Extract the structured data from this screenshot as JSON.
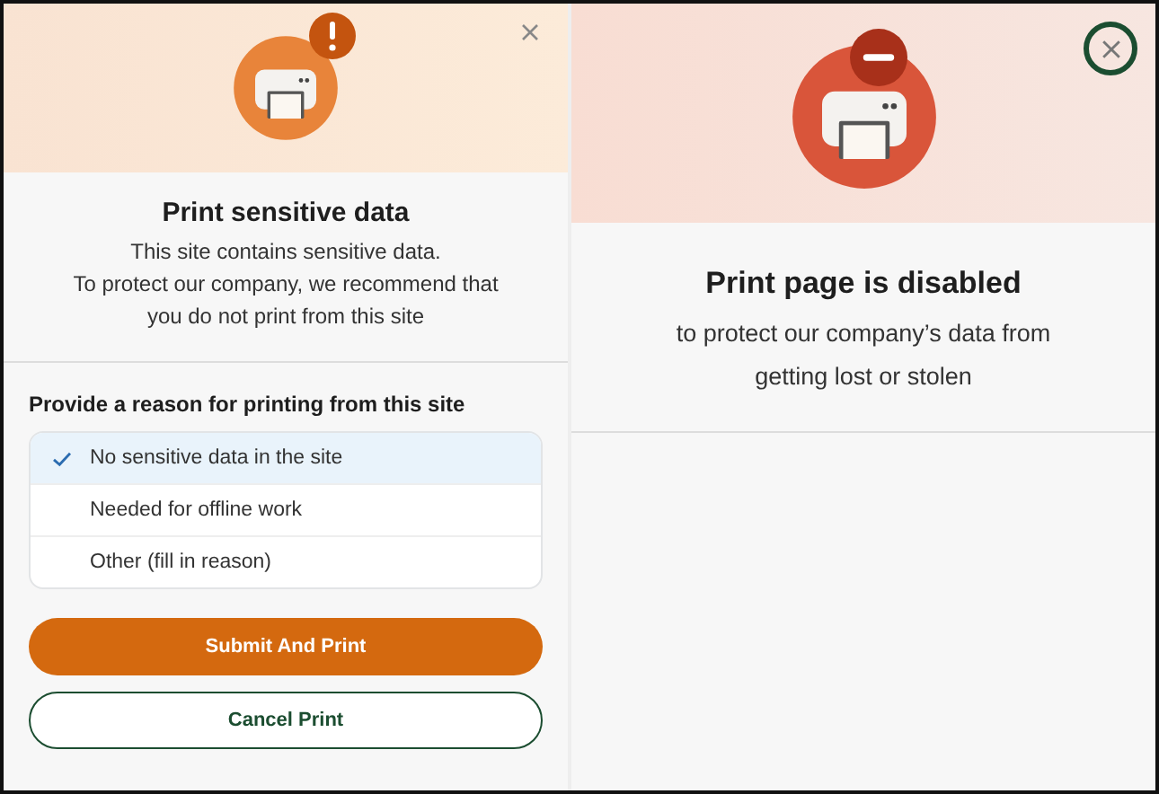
{
  "left_dialog": {
    "badge": {
      "kind": "warning"
    },
    "title": "Print sensitive data",
    "description": [
      "This site contains sensitive data.",
      "To protect our company, we recommend that",
      "you do not print from this site"
    ],
    "reason_label": "Provide a reason for printing from this site",
    "reasons": [
      {
        "label": "No sensitive data in the site",
        "selected": true
      },
      {
        "label": "Needed for offline work",
        "selected": false
      },
      {
        "label": "Other (fill in reason)",
        "selected": false
      }
    ],
    "buttons": [
      {
        "label": "Submit And Print",
        "kind": "primary"
      },
      {
        "label": "Cancel Print",
        "kind": "secondary"
      }
    ],
    "close": {
      "focused": false
    }
  },
  "right_dialog": {
    "badge": {
      "kind": "blocked"
    },
    "title": "Print page is disabled",
    "description": [
      "to protect our company’s data from",
      "getting lost or stolen"
    ],
    "close": {
      "focused": true
    }
  }
}
